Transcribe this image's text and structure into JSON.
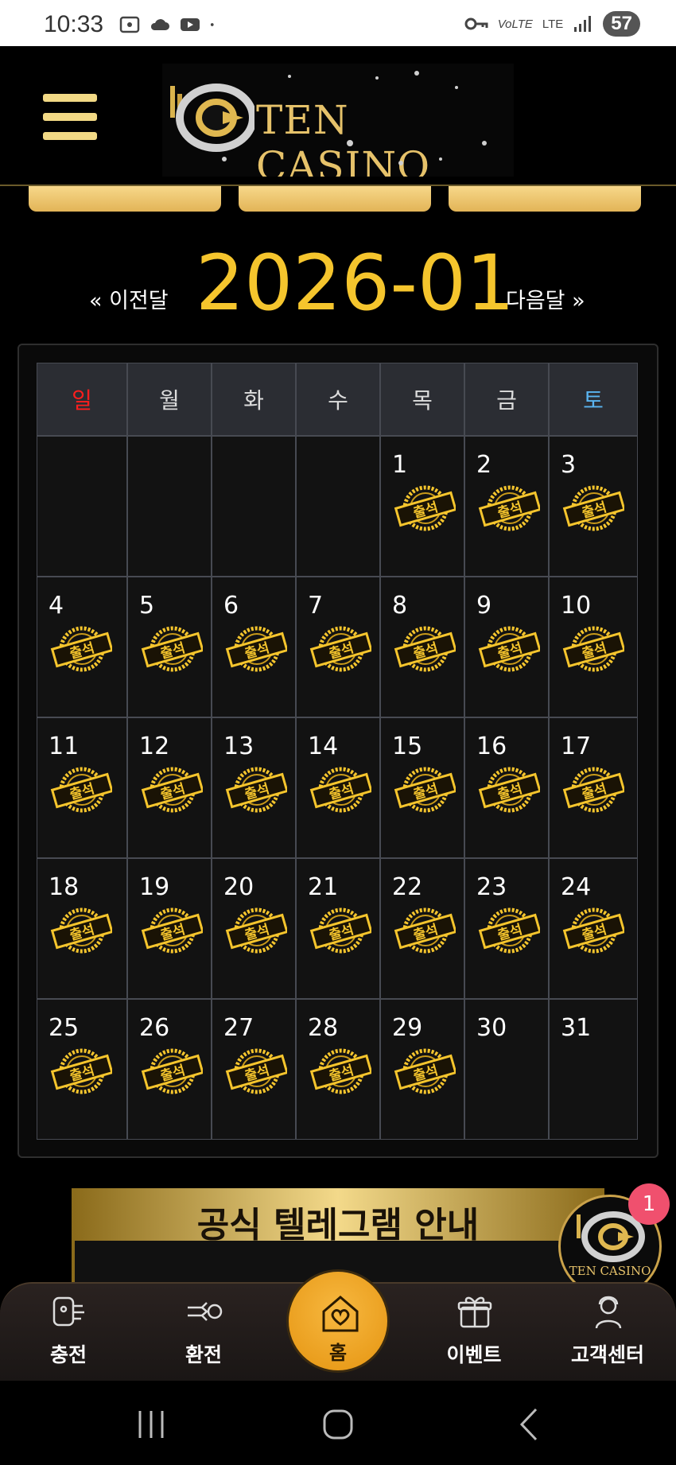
{
  "status_bar": {
    "time": "10:33",
    "lte": "LTE",
    "volte": "VoLTE",
    "battery": "57"
  },
  "header": {
    "logo_text": "TEN CASINO"
  },
  "top_buttons": [
    "",
    "",
    ""
  ],
  "calendar": {
    "prev_label": "« 이전달",
    "next_label": "다음달 »",
    "month": "2026-01",
    "weekdays": [
      "일",
      "월",
      "화",
      "수",
      "목",
      "금",
      "토"
    ],
    "stamp_label": "출석",
    "days": [
      "1",
      "2",
      "3",
      "4",
      "5",
      "6",
      "7",
      "8",
      "9",
      "10",
      "11",
      "12",
      "13",
      "14",
      "15",
      "16",
      "17",
      "18",
      "19",
      "20",
      "21",
      "22",
      "23",
      "24",
      "25",
      "26",
      "27",
      "28",
      "29",
      "30",
      "31"
    ],
    "attended_until": 29,
    "first_weekday_index": 4
  },
  "banner": {
    "title": "공식 텔레그램 안내"
  },
  "floating": {
    "logo_text": "TEN CASINO",
    "badge_count": "1"
  },
  "bottom_nav": {
    "items": [
      {
        "label": "충전",
        "icon": "deposit-icon"
      },
      {
        "label": "환전",
        "icon": "exchange-icon"
      },
      {
        "label": "홈",
        "icon": "home-heart-icon"
      },
      {
        "label": "이벤트",
        "icon": "gift-icon"
      },
      {
        "label": "고객센터",
        "icon": "support-icon"
      }
    ]
  },
  "colors": {
    "gold": "#f5c52d",
    "sunday": "#ff1e1e",
    "saturday": "#5ab4f0",
    "home_orange": "#f0a524"
  }
}
